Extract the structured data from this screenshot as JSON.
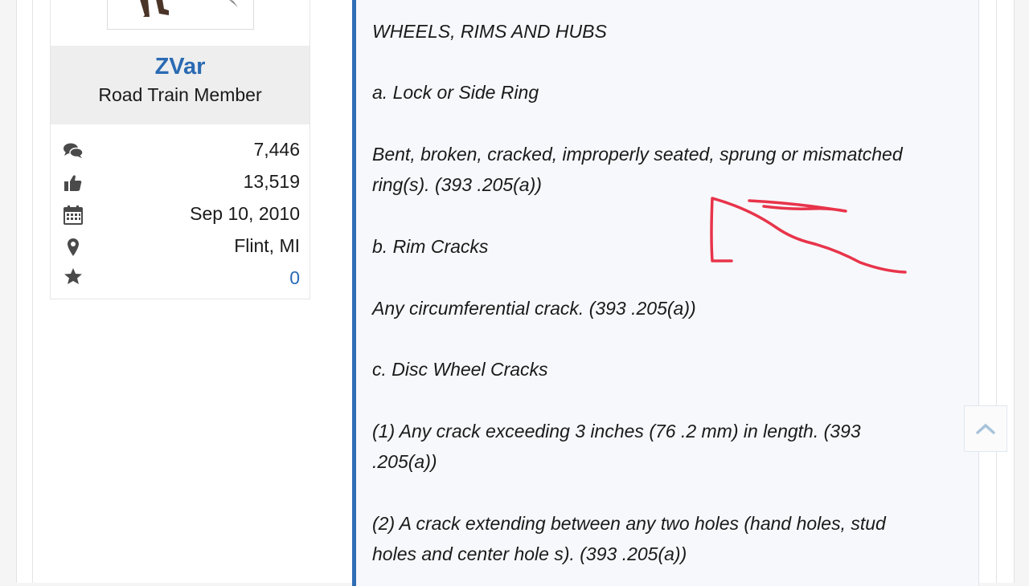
{
  "user": {
    "name": "ZVar",
    "title": "Road Train Member",
    "stats": [
      {
        "icon": "messages-icon",
        "value": "7,446"
      },
      {
        "icon": "thumbs-up-icon",
        "value": "13,519"
      },
      {
        "icon": "calendar-icon",
        "value": "Sep 10, 2010"
      },
      {
        "icon": "location-pin-icon",
        "value": "Flint, MI"
      },
      {
        "icon": "star-icon",
        "value": "0"
      }
    ]
  },
  "post": {
    "lines": [
      "WHEELS, RIMS AND HUBS",
      "a. Lock or Side Ring",
      "Bent, broken, cracked, improperly seated, sprung or mismatched",
      "ring(s). (393 .205(a))",
      "b. Rim Cracks",
      "Any circumferential crack. (393 .205(a))",
      "c. Disc Wheel Cracks",
      "(1) Any crack exceeding 3 inches (76 .2 mm) in length. (393",
      ".205(a))",
      "(2) A crack extending between any two holes (hand holes, stud",
      "holes and center hole s). (393 .205(a))"
    ]
  },
  "colors": {
    "accent": "#2f6db5",
    "username": "#2a6bb3",
    "annotation": "#e8344a"
  },
  "icons": {
    "scroll_top": "chevron-up-icon"
  }
}
